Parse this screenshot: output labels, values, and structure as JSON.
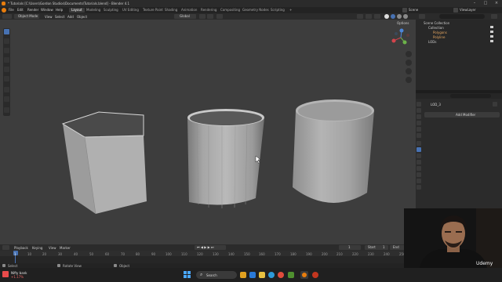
{
  "window": {
    "title": "* Tutorials [C:\\Users\\Gordon Studios\\Documents\\Tutorials.blend] - Blender 4.1"
  },
  "menubar": {
    "items": [
      "File",
      "Edit",
      "Render",
      "Window",
      "Help"
    ],
    "tabs": [
      "Layout",
      "Modeling",
      "Sculpting",
      "UV Editing",
      "Texture Paint",
      "Shading",
      "Animation",
      "Rendering",
      "Compositing",
      "Geometry Nodes",
      "Scripting"
    ],
    "active_tab": "Layout",
    "scene": "Scene",
    "view_layer": "ViewLayer"
  },
  "viewport_header": {
    "mode": "Object Mode",
    "items": [
      "View",
      "Select",
      "Add",
      "Object"
    ],
    "orientation": "Global",
    "options": "Options"
  },
  "outliner": {
    "rows": [
      "Scene Collection",
      "Collection",
      "Polygons",
      "Polyline",
      "LODs"
    ]
  },
  "properties": {
    "object_name": "LOD_3",
    "add_modifier": "Add Modifier"
  },
  "timeline": {
    "menu": [
      "Playback",
      "Keying",
      "View",
      "Marker"
    ],
    "start_label": "Start",
    "start_value": "1",
    "end_label": "End",
    "end_value": "250",
    "current_frame": "1",
    "ticks": [
      "1",
      "10",
      "20",
      "30",
      "40",
      "50",
      "60",
      "70",
      "80",
      "90",
      "100",
      "110",
      "120",
      "130",
      "140",
      "150",
      "160",
      "170",
      "180",
      "190",
      "200",
      "210",
      "220",
      "230",
      "240",
      "250"
    ]
  },
  "statusbar": {
    "items": [
      "Select",
      "Rotate View",
      "Object"
    ]
  },
  "taskbar": {
    "weather": "Nifty bank",
    "weather_sub": "+1.17%",
    "search": "Search"
  },
  "watermark": "Udemy",
  "colors": {
    "accent": "#4772b3",
    "viewport": "#3d3d3d"
  }
}
